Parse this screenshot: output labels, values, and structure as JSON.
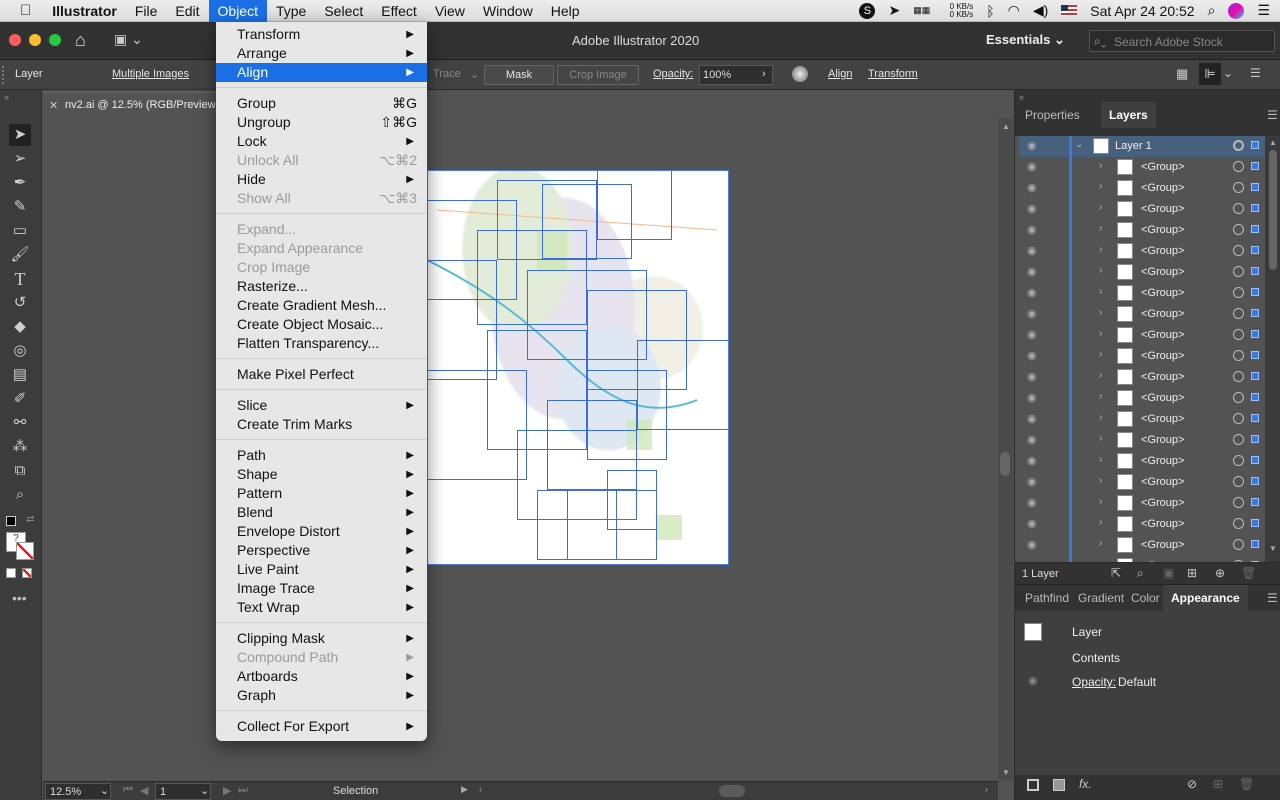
{
  "menubar": {
    "apple": "",
    "app": "Illustrator",
    "items": [
      "File",
      "Edit",
      "Object",
      "Type",
      "Select",
      "Effect",
      "View",
      "Window",
      "Help"
    ],
    "active": "Object",
    "net_up": "0 KB/s",
    "net_down": "0 KB/s",
    "datetime": "Sat Apr 24  20:52"
  },
  "titlebar": {
    "title": "Adobe Illustrator 2020",
    "workspace": "Essentials",
    "search_placeholder": "Search Adobe Stock"
  },
  "control": {
    "layer": "Layer",
    "selection": "Multiple Images",
    "trace": "Trace",
    "mask": "Mask",
    "crop": "Crop Image",
    "opacity_label": "Opacity:",
    "opacity_value": "100%",
    "align": "Align",
    "transform": "Transform"
  },
  "doc": {
    "tab": "nv2.ai @ 12.5% (RGB/Preview)"
  },
  "status": {
    "zoom": "12.5%",
    "page": "1",
    "tool": "Selection"
  },
  "panels": {
    "tab_properties": "Properties",
    "tab_layers": "Layers",
    "layer_top": "Layer 1",
    "group_label": "<Group>",
    "layer_count": "1 Layer",
    "tab_pathfinder": "Pathfind",
    "tab_gradient": "Gradient",
    "tab_color": "Color",
    "tab_appearance": "Appearance",
    "appearance_layer": "Layer",
    "appearance_contents": "Contents",
    "appearance_opacity_label": "Opacity:",
    "appearance_opacity_value": "Default"
  },
  "object_menu": [
    {
      "label": "Transform",
      "sub": true
    },
    {
      "label": "Arrange",
      "sub": true
    },
    {
      "label": "Align",
      "sub": true,
      "highlight": true
    },
    {
      "sep": true
    },
    {
      "label": "Group",
      "shortcut": "⌘G"
    },
    {
      "label": "Ungroup",
      "shortcut": "⇧⌘G"
    },
    {
      "label": "Lock",
      "sub": true
    },
    {
      "label": "Unlock All",
      "shortcut": "⌥⌘2",
      "disabled": true
    },
    {
      "label": "Hide",
      "sub": true
    },
    {
      "label": "Show All",
      "shortcut": "⌥⌘3",
      "disabled": true
    },
    {
      "sep": true
    },
    {
      "label": "Expand...",
      "disabled": true
    },
    {
      "label": "Expand Appearance",
      "disabled": true
    },
    {
      "label": "Crop Image",
      "disabled": true
    },
    {
      "label": "Rasterize..."
    },
    {
      "label": "Create Gradient Mesh..."
    },
    {
      "label": "Create Object Mosaic..."
    },
    {
      "label": "Flatten Transparency..."
    },
    {
      "sep": true
    },
    {
      "label": "Make Pixel Perfect"
    },
    {
      "sep": true
    },
    {
      "label": "Slice",
      "sub": true
    },
    {
      "label": "Create Trim Marks"
    },
    {
      "sep": true
    },
    {
      "label": "Path",
      "sub": true
    },
    {
      "label": "Shape",
      "sub": true
    },
    {
      "label": "Pattern",
      "sub": true
    },
    {
      "label": "Blend",
      "sub": true
    },
    {
      "label": "Envelope Distort",
      "sub": true
    },
    {
      "label": "Perspective",
      "sub": true
    },
    {
      "label": "Live Paint",
      "sub": true
    },
    {
      "label": "Image Trace",
      "sub": true
    },
    {
      "label": "Text Wrap",
      "sub": true
    },
    {
      "sep": true
    },
    {
      "label": "Clipping Mask",
      "sub": true
    },
    {
      "label": "Compound Path",
      "sub": true,
      "disabled": true
    },
    {
      "label": "Artboards",
      "sub": true
    },
    {
      "label": "Graph",
      "sub": true
    },
    {
      "sep": true
    },
    {
      "label": "Collect For Export",
      "sub": true
    }
  ],
  "icons": {
    "chevron_right": "▶",
    "eye": "◉"
  }
}
